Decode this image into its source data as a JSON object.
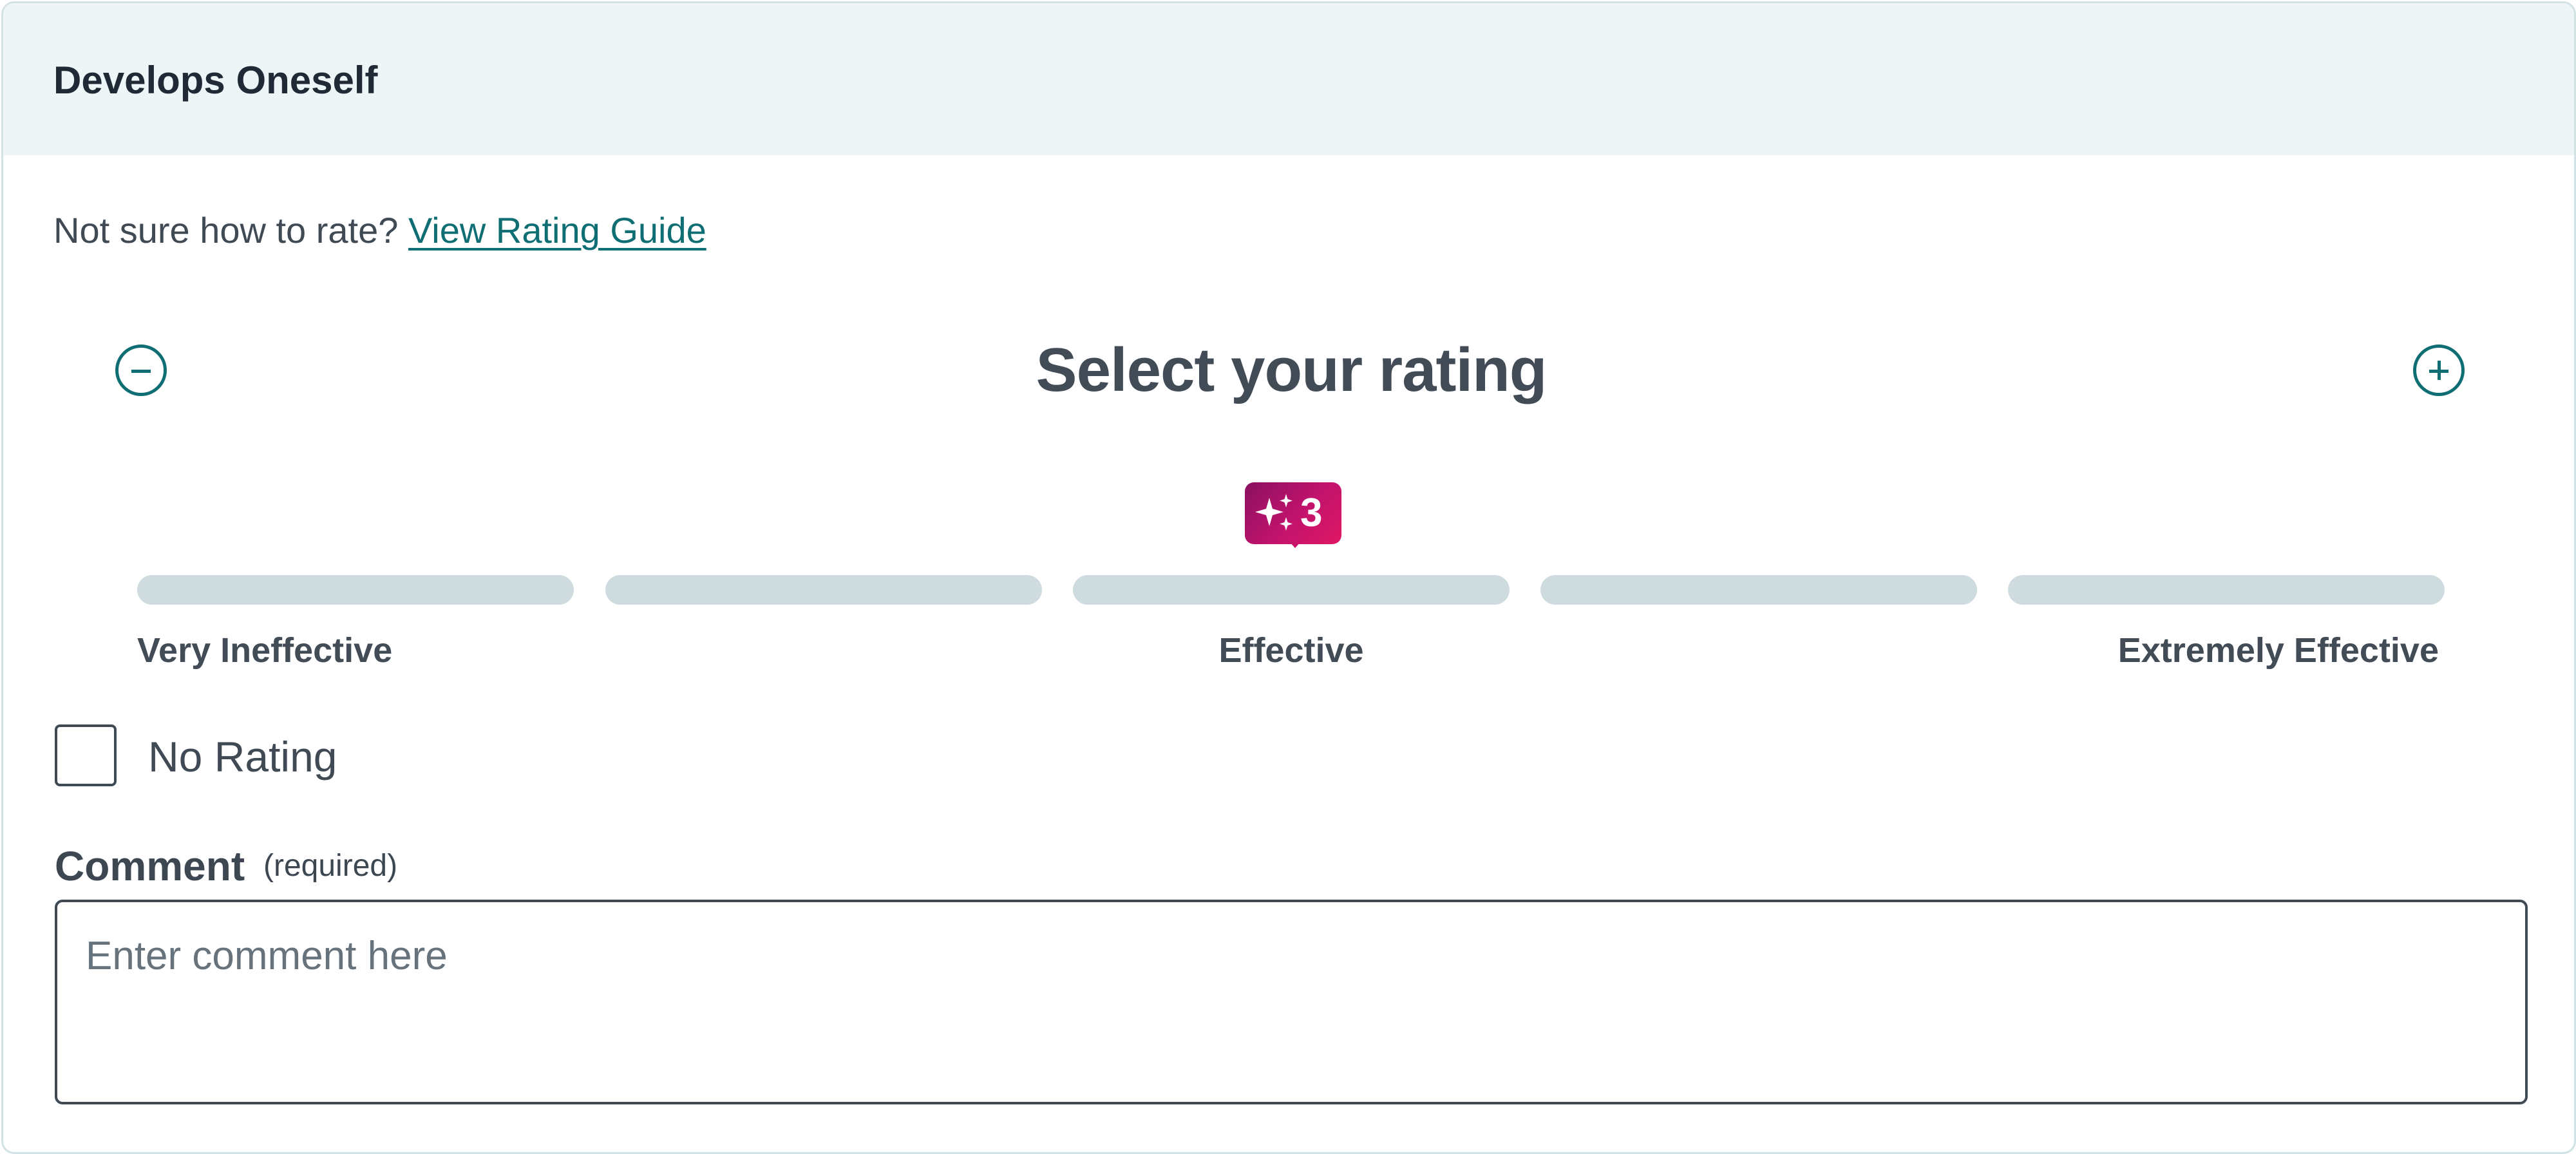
{
  "card": {
    "title": "Develops Oneself"
  },
  "guide": {
    "prompt": "Not sure how to rate?",
    "link_label": "View Rating Guide"
  },
  "rating": {
    "heading": "Select your rating",
    "current_value": "3",
    "segments_total": 5,
    "labels": {
      "low": "Very Ineffective",
      "mid": "Effective",
      "high": "Extremely Effective"
    },
    "badge_icon": "sparkle-icon",
    "decrease_icon": "minus-circle-icon",
    "increase_icon": "plus-circle-icon"
  },
  "no_rating": {
    "label": "No Rating",
    "checked": false
  },
  "comment": {
    "label": "Comment",
    "required_note": "(required)",
    "value": "",
    "placeholder": "Enter comment here"
  },
  "colors": {
    "accent": "#0e6e73",
    "header_bg": "#edf5f7",
    "segment": "#cfdcdf",
    "badge_start": "#8a1060",
    "badge_end": "#e01763"
  }
}
